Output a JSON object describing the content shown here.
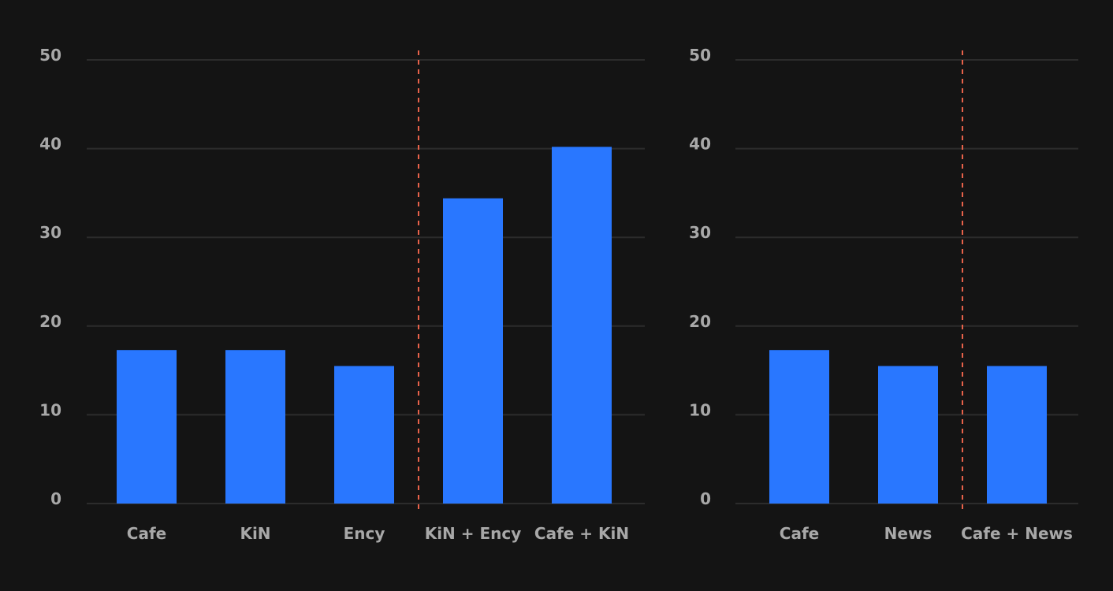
{
  "colors": {
    "background": "#141414",
    "bar": "#2977ff",
    "grid": "#2c2c2c",
    "divider": "#e8624a",
    "text": "#a8a8a8"
  },
  "chart_data": [
    {
      "type": "bar",
      "title": "",
      "xlabel": "",
      "ylabel": "",
      "ylim": [
        0,
        50
      ],
      "yticks": [
        0,
        10,
        20,
        30,
        40,
        50
      ],
      "grid": true,
      "categories": [
        "Cafe",
        "KiN",
        "Ency",
        "KiN + Ency",
        "Cafe + KiN"
      ],
      "values": [
        17.3,
        17.3,
        15.5,
        34.4,
        40.2
      ],
      "divider_after_index": 2,
      "legend": "none"
    },
    {
      "type": "bar",
      "title": "",
      "xlabel": "",
      "ylabel": "",
      "ylim": [
        0,
        50
      ],
      "yticks": [
        0,
        10,
        20,
        30,
        40,
        50
      ],
      "grid": true,
      "categories": [
        "Cafe",
        "News",
        "Cafe + News"
      ],
      "values": [
        17.3,
        15.5,
        15.5
      ],
      "divider_after_index": 1,
      "legend": "none"
    }
  ]
}
